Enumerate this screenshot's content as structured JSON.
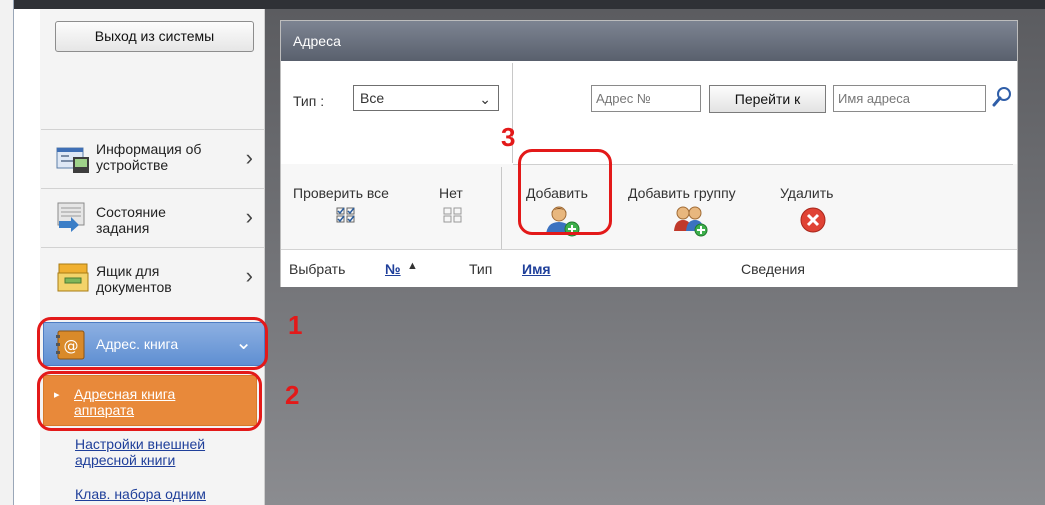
{
  "sidebar": {
    "logout_label": "Выход из системы",
    "items": [
      {
        "label_line1": "Информация об",
        "label_line2": "устройстве"
      },
      {
        "label_line1": "Состояние",
        "label_line2": "задания"
      },
      {
        "label_line1": "Ящик для",
        "label_line2": "документов"
      }
    ],
    "active_item": {
      "label": "Адрес. книга"
    },
    "sub_items": [
      {
        "label_line1": "Адресная книга",
        "label_line2": "аппарата"
      },
      {
        "label_line1": "Настройки внешней",
        "label_line2": "адресной книги"
      },
      {
        "label_line1": "Клав. набора одним",
        "label_line2": ""
      }
    ]
  },
  "panel": {
    "title": "Адреса",
    "type_label": "Тип :",
    "type_value": "Все",
    "address_no_placeholder": "Адрес №",
    "goto_label": "Перейти к",
    "address_name_placeholder": "Имя адреса",
    "actions": {
      "check_all": "Проверить все",
      "none": "Нет",
      "add": "Добавить",
      "add_group": "Добавить группу",
      "delete": "Удалить"
    },
    "columns": {
      "select": "Выбрать",
      "number": "№",
      "sort_indicator": "▲",
      "type": "Тип",
      "name": "Имя",
      "details": "Сведения"
    }
  },
  "annotations": {
    "step1": "1",
    "step2": "2",
    "step3": "3",
    "highlight_color": "#e31919"
  },
  "colors": {
    "active_nav": "#5f8fd2",
    "active_sub": "#e8893a",
    "link": "#1f3f9a"
  }
}
